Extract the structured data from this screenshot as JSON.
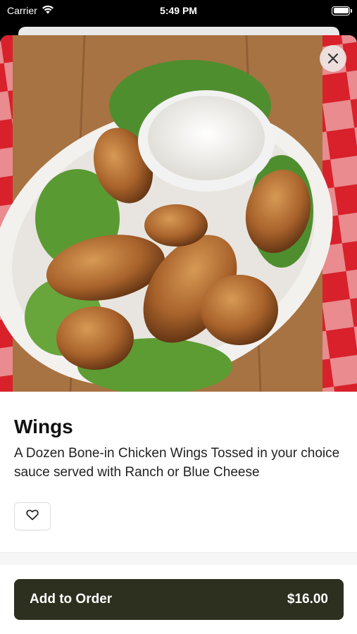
{
  "status_bar": {
    "carrier": "Carrier",
    "time": "5:49 PM",
    "icons": [
      "wifi-icon",
      "battery-icon"
    ]
  },
  "item": {
    "image": "chicken-wings-photo",
    "title": "Wings",
    "description": "A Dozen Bone-in Chicken Wings Tossed in your choice sauce served with Ranch or Blue Cheese"
  },
  "actions": {
    "close_icon": "close-icon",
    "favorite_icon": "heart-icon",
    "add_to_order_label": "Add to Order",
    "price": "$16.00"
  },
  "colors": {
    "primary_button": "#2d2f1f",
    "close_button_bg": "#eee6e6"
  }
}
